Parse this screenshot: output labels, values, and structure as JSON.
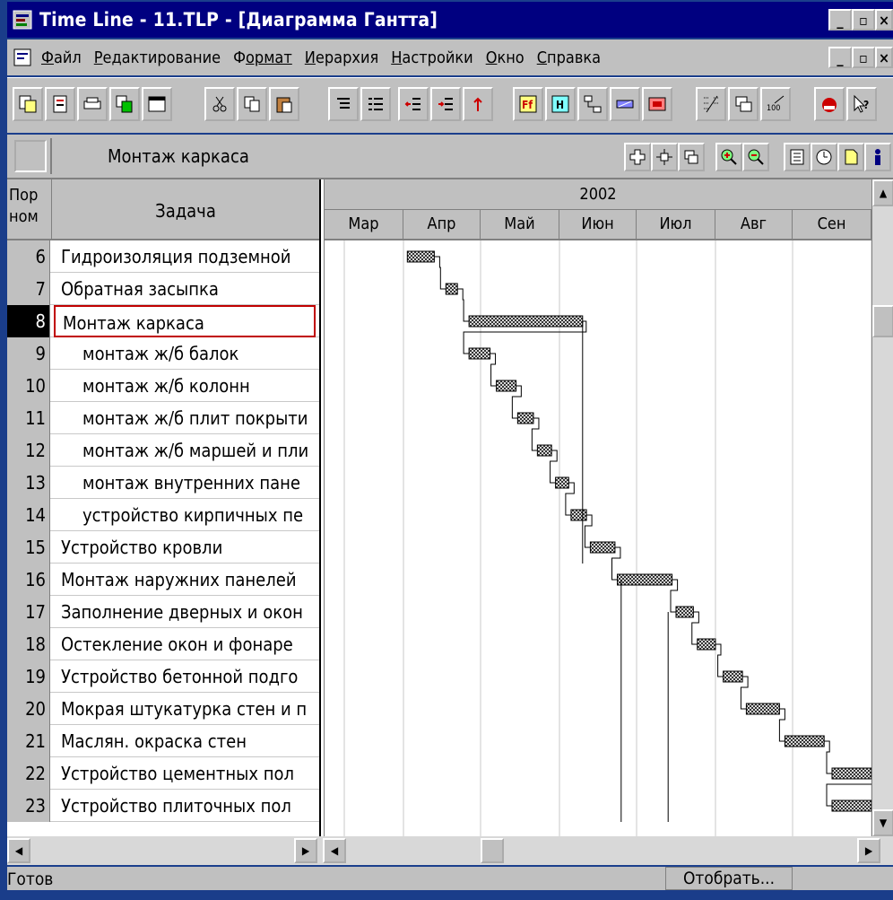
{
  "window": {
    "title": "Time Line - 11.TLP - [Диаграмма Гантта]"
  },
  "menu": {
    "items": [
      {
        "label": "Файл",
        "hotkey": "Ф",
        "rest": "айл"
      },
      {
        "label": "Редактирование",
        "hotkey": "Р",
        "rest": "едактирование"
      },
      {
        "label": "Формат",
        "hotkey": "Ф",
        "rest": "ормат"
      },
      {
        "label": "Иерархия",
        "hotkey": "И",
        "rest": "ерархия"
      },
      {
        "label": "Настройки",
        "hotkey": "Н",
        "rest": "астройки"
      },
      {
        "label": "Окно",
        "hotkey": "О",
        "rest": "кно"
      },
      {
        "label": "Справка",
        "hotkey": "С",
        "rest": "правка"
      }
    ]
  },
  "editbar": {
    "value": "Монтаж каркаса"
  },
  "table": {
    "num_header_line1": "Пор",
    "num_header_line2": "ном",
    "task_header": "Задача",
    "rows": [
      {
        "num": "6",
        "task": "Гидроизоляция подземной",
        "sub": false,
        "selected": false
      },
      {
        "num": "7",
        "task": "Обратная засыпка",
        "sub": false,
        "selected": false
      },
      {
        "num": "8",
        "task": "Монтаж каркаса",
        "sub": false,
        "selected": true
      },
      {
        "num": "9",
        "task": "монтаж ж/б балок",
        "sub": true,
        "selected": false
      },
      {
        "num": "10",
        "task": "монтаж ж/б колонн",
        "sub": true,
        "selected": false
      },
      {
        "num": "11",
        "task": "монтаж ж/б плит покрыти",
        "sub": true,
        "selected": false
      },
      {
        "num": "12",
        "task": "монтаж ж/б маршей и пли",
        "sub": true,
        "selected": false
      },
      {
        "num": "13",
        "task": "монтаж внутренних пане",
        "sub": true,
        "selected": false
      },
      {
        "num": "14",
        "task": "устройство кирпичных пе",
        "sub": true,
        "selected": false
      },
      {
        "num": "15",
        "task": "Устройство кровли",
        "sub": false,
        "selected": false
      },
      {
        "num": "16",
        "task": "Монтаж наружних панелей",
        "sub": false,
        "selected": false
      },
      {
        "num": "17",
        "task": "Заполнение дверных и окон",
        "sub": false,
        "selected": false
      },
      {
        "num": "18",
        "task": "Остекление окон и фонаре",
        "sub": false,
        "selected": false
      },
      {
        "num": "19",
        "task": "Устройство бетонной подго",
        "sub": false,
        "selected": false
      },
      {
        "num": "20",
        "task": "Мокрая штукатурка стен и п",
        "sub": false,
        "selected": false
      },
      {
        "num": "21",
        "task": "Маслян. окраска стен",
        "sub": false,
        "selected": false
      },
      {
        "num": "22",
        "task": "Устройство цементных пол",
        "sub": false,
        "selected": false
      },
      {
        "num": "23",
        "task": "Устройство плиточных пол",
        "sub": false,
        "selected": false
      }
    ]
  },
  "gantt": {
    "year": "2002",
    "months": [
      "Мар",
      "Апр",
      "Май",
      "Июн",
      "Июл",
      "Авг",
      "Сен"
    ],
    "bars": [
      {
        "row": 0,
        "start_month": 1.05,
        "end_month": 1.4
      },
      {
        "row": 1,
        "start_month": 1.55,
        "end_month": 1.7
      },
      {
        "row": 2,
        "start_month": 1.85,
        "end_month": 3.3
      },
      {
        "row": 3,
        "start_month": 1.85,
        "end_month": 2.12
      },
      {
        "row": 4,
        "start_month": 2.2,
        "end_month": 2.45
      },
      {
        "row": 5,
        "start_month": 2.47,
        "end_month": 2.67
      },
      {
        "row": 6,
        "start_month": 2.72,
        "end_month": 2.9
      },
      {
        "row": 7,
        "start_month": 2.95,
        "end_month": 3.12
      },
      {
        "row": 8,
        "start_month": 3.15,
        "end_month": 3.35
      },
      {
        "row": 9,
        "start_month": 3.4,
        "end_month": 3.72
      },
      {
        "row": 10,
        "start_month": 3.75,
        "end_month": 4.45
      },
      {
        "row": 11,
        "start_month": 4.5,
        "end_month": 4.72
      },
      {
        "row": 12,
        "start_month": 4.77,
        "end_month": 5.0
      },
      {
        "row": 13,
        "start_month": 5.1,
        "end_month": 5.35
      },
      {
        "row": 14,
        "start_month": 5.4,
        "end_month": 5.83
      },
      {
        "row": 15,
        "start_month": 5.9,
        "end_month": 6.4
      },
      {
        "row": 16,
        "start_month": 6.5,
        "end_month": 7.0
      },
      {
        "row": 17,
        "start_month": 6.5,
        "end_month": 7.0
      }
    ],
    "long_links": [
      {
        "from_row": 2,
        "to_row": 9,
        "at_month": 3.3
      },
      {
        "from_row": 10,
        "to_row": 17,
        "at_month": 3.8
      },
      {
        "from_row": 11,
        "to_row": 17,
        "at_month": 4.4
      }
    ]
  },
  "status": {
    "text": "Готов",
    "button": "Отобрать..."
  },
  "colors": {
    "background": "#1b3f8c",
    "titlebar": "#000080",
    "chrome": "#c0c0c0",
    "selection_border": "#c00000"
  }
}
